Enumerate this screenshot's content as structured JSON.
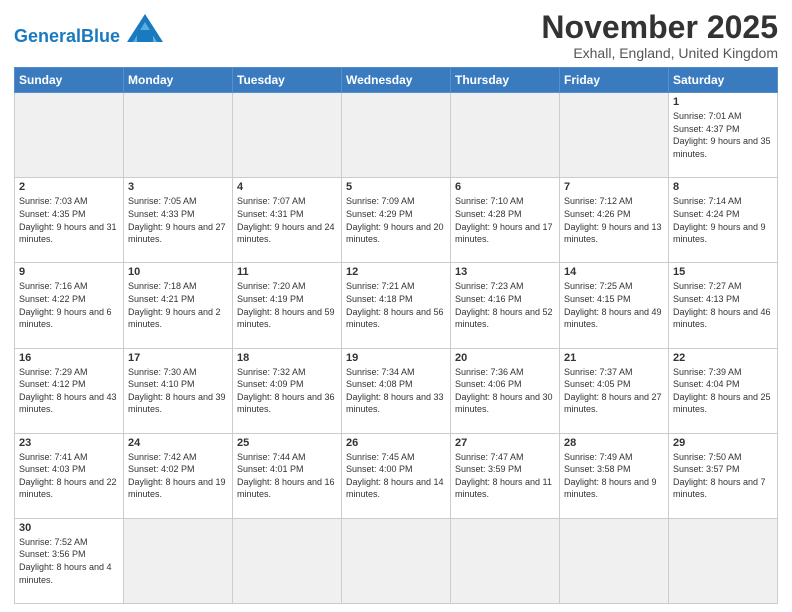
{
  "header": {
    "logo_general": "General",
    "logo_blue": "Blue",
    "month_title": "November 2025",
    "location": "Exhall, England, United Kingdom"
  },
  "weekdays": [
    "Sunday",
    "Monday",
    "Tuesday",
    "Wednesday",
    "Thursday",
    "Friday",
    "Saturday"
  ],
  "weeks": [
    [
      {
        "day": "",
        "empty": true
      },
      {
        "day": "",
        "empty": true
      },
      {
        "day": "",
        "empty": true
      },
      {
        "day": "",
        "empty": true
      },
      {
        "day": "",
        "empty": true
      },
      {
        "day": "",
        "empty": true
      },
      {
        "day": "1",
        "sunrise": "7:01 AM",
        "sunset": "4:37 PM",
        "daylight": "9 hours and 35 minutes."
      }
    ],
    [
      {
        "day": "2",
        "sunrise": "7:03 AM",
        "sunset": "4:35 PM",
        "daylight": "9 hours and 31 minutes."
      },
      {
        "day": "3",
        "sunrise": "7:05 AM",
        "sunset": "4:33 PM",
        "daylight": "9 hours and 27 minutes."
      },
      {
        "day": "4",
        "sunrise": "7:07 AM",
        "sunset": "4:31 PM",
        "daylight": "9 hours and 24 minutes."
      },
      {
        "day": "5",
        "sunrise": "7:09 AM",
        "sunset": "4:29 PM",
        "daylight": "9 hours and 20 minutes."
      },
      {
        "day": "6",
        "sunrise": "7:10 AM",
        "sunset": "4:28 PM",
        "daylight": "9 hours and 17 minutes."
      },
      {
        "day": "7",
        "sunrise": "7:12 AM",
        "sunset": "4:26 PM",
        "daylight": "9 hours and 13 minutes."
      },
      {
        "day": "8",
        "sunrise": "7:14 AM",
        "sunset": "4:24 PM",
        "daylight": "9 hours and 9 minutes."
      }
    ],
    [
      {
        "day": "9",
        "sunrise": "7:16 AM",
        "sunset": "4:22 PM",
        "daylight": "9 hours and 6 minutes."
      },
      {
        "day": "10",
        "sunrise": "7:18 AM",
        "sunset": "4:21 PM",
        "daylight": "9 hours and 2 minutes."
      },
      {
        "day": "11",
        "sunrise": "7:20 AM",
        "sunset": "4:19 PM",
        "daylight": "8 hours and 59 minutes."
      },
      {
        "day": "12",
        "sunrise": "7:21 AM",
        "sunset": "4:18 PM",
        "daylight": "8 hours and 56 minutes."
      },
      {
        "day": "13",
        "sunrise": "7:23 AM",
        "sunset": "4:16 PM",
        "daylight": "8 hours and 52 minutes."
      },
      {
        "day": "14",
        "sunrise": "7:25 AM",
        "sunset": "4:15 PM",
        "daylight": "8 hours and 49 minutes."
      },
      {
        "day": "15",
        "sunrise": "7:27 AM",
        "sunset": "4:13 PM",
        "daylight": "8 hours and 46 minutes."
      }
    ],
    [
      {
        "day": "16",
        "sunrise": "7:29 AM",
        "sunset": "4:12 PM",
        "daylight": "8 hours and 43 minutes."
      },
      {
        "day": "17",
        "sunrise": "7:30 AM",
        "sunset": "4:10 PM",
        "daylight": "8 hours and 39 minutes."
      },
      {
        "day": "18",
        "sunrise": "7:32 AM",
        "sunset": "4:09 PM",
        "daylight": "8 hours and 36 minutes."
      },
      {
        "day": "19",
        "sunrise": "7:34 AM",
        "sunset": "4:08 PM",
        "daylight": "8 hours and 33 minutes."
      },
      {
        "day": "20",
        "sunrise": "7:36 AM",
        "sunset": "4:06 PM",
        "daylight": "8 hours and 30 minutes."
      },
      {
        "day": "21",
        "sunrise": "7:37 AM",
        "sunset": "4:05 PM",
        "daylight": "8 hours and 27 minutes."
      },
      {
        "day": "22",
        "sunrise": "7:39 AM",
        "sunset": "4:04 PM",
        "daylight": "8 hours and 25 minutes."
      }
    ],
    [
      {
        "day": "23",
        "sunrise": "7:41 AM",
        "sunset": "4:03 PM",
        "daylight": "8 hours and 22 minutes."
      },
      {
        "day": "24",
        "sunrise": "7:42 AM",
        "sunset": "4:02 PM",
        "daylight": "8 hours and 19 minutes."
      },
      {
        "day": "25",
        "sunrise": "7:44 AM",
        "sunset": "4:01 PM",
        "daylight": "8 hours and 16 minutes."
      },
      {
        "day": "26",
        "sunrise": "7:45 AM",
        "sunset": "4:00 PM",
        "daylight": "8 hours and 14 minutes."
      },
      {
        "day": "27",
        "sunrise": "7:47 AM",
        "sunset": "3:59 PM",
        "daylight": "8 hours and 11 minutes."
      },
      {
        "day": "28",
        "sunrise": "7:49 AM",
        "sunset": "3:58 PM",
        "daylight": "8 hours and 9 minutes."
      },
      {
        "day": "29",
        "sunrise": "7:50 AM",
        "sunset": "3:57 PM",
        "daylight": "8 hours and 7 minutes."
      }
    ],
    [
      {
        "day": "30",
        "sunrise": "7:52 AM",
        "sunset": "3:56 PM",
        "daylight": "8 hours and 4 minutes."
      },
      {
        "day": "",
        "empty": true
      },
      {
        "day": "",
        "empty": true
      },
      {
        "day": "",
        "empty": true
      },
      {
        "day": "",
        "empty": true
      },
      {
        "day": "",
        "empty": true
      },
      {
        "day": "",
        "empty": true
      }
    ]
  ]
}
